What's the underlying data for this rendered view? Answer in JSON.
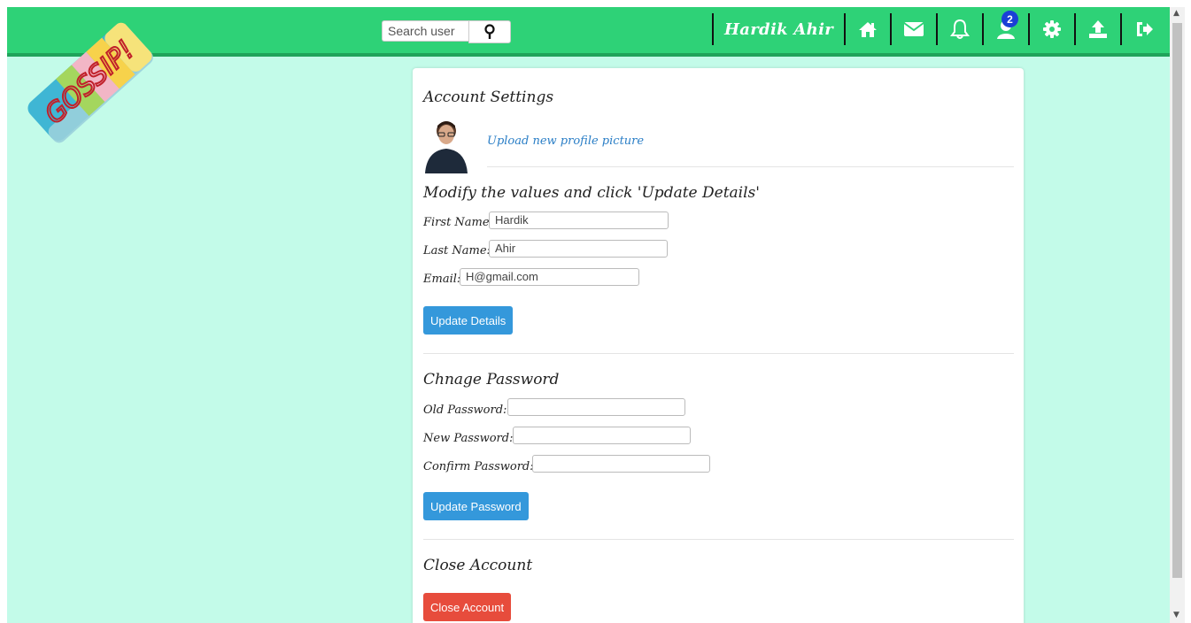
{
  "brand": {
    "logo_text": "GOSSIP!"
  },
  "search": {
    "placeholder": "Search user",
    "button_icon": "search-icon"
  },
  "nav": {
    "username": "Hardik Ahir",
    "icons": [
      "home-icon",
      "mail-icon",
      "bell-icon",
      "friend-requests-icon",
      "gear-icon",
      "upload-icon",
      "logout-icon"
    ],
    "friend_requests_count": "2"
  },
  "account": {
    "title": "Account Settings",
    "upload_link": "Upload new profile picture"
  },
  "details": {
    "heading": "Modify the values and click 'Update Details'",
    "first_name_label": "First Name:",
    "first_name_value": "Hardik",
    "last_name_label": "Last Name:",
    "last_name_value": "Ahir",
    "email_label": "Email:",
    "email_value": "H@gmail.com",
    "button": "Update Details"
  },
  "password": {
    "heading": "Chnage Password",
    "old_label": "Old Password:",
    "new_label": "New Password:",
    "confirm_label": "Confirm Password:",
    "button": "Update Password"
  },
  "close": {
    "heading": "Close Account",
    "button": "Close Account"
  },
  "colors": {
    "topbar": "#2ed277",
    "background": "#c3fbe9",
    "primary_button": "#3498db",
    "danger_button": "#e74c3c"
  }
}
